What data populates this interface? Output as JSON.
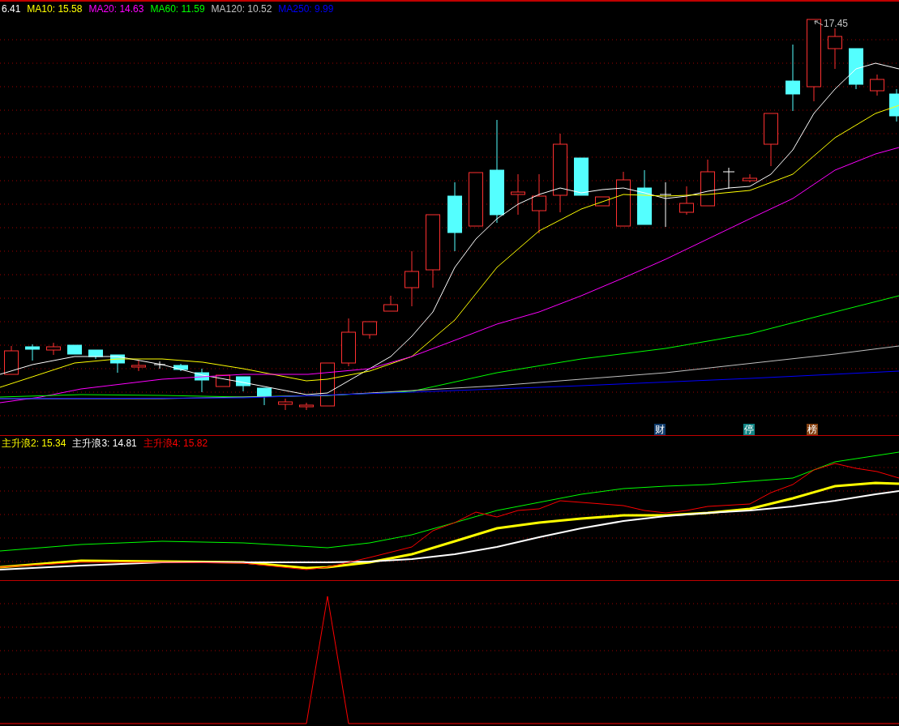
{
  "main_panel": {
    "legend": [
      {
        "label": "6.41",
        "color": "#ffffff"
      },
      {
        "label": "MA10: 15.58",
        "color": "#ffff00"
      },
      {
        "label": "MA20: 14.63",
        "color": "#ff00ff"
      },
      {
        "label": "MA60: 11.59",
        "color": "#00ff00"
      },
      {
        "label": "MA120: 10.52",
        "color": "#c0c0c0"
      },
      {
        "label": "MA250: 9.99",
        "color": "#0000ff"
      }
    ],
    "high_label": "17.45",
    "badges": [
      {
        "label": "财",
        "color": "#103c6c"
      },
      {
        "label": "停",
        "color": "#108484"
      },
      {
        "label": "榜",
        "color": "#844010"
      }
    ]
  },
  "indicator_panel": {
    "legend": [
      {
        "label": "主升浪2: 15.34",
        "color": "#ffff00"
      },
      {
        "label": "主升浪3: 14.81",
        "color": "#ffffff"
      },
      {
        "label": "主升浪4: 15.82",
        "color": "#ff0000"
      }
    ]
  }
}
